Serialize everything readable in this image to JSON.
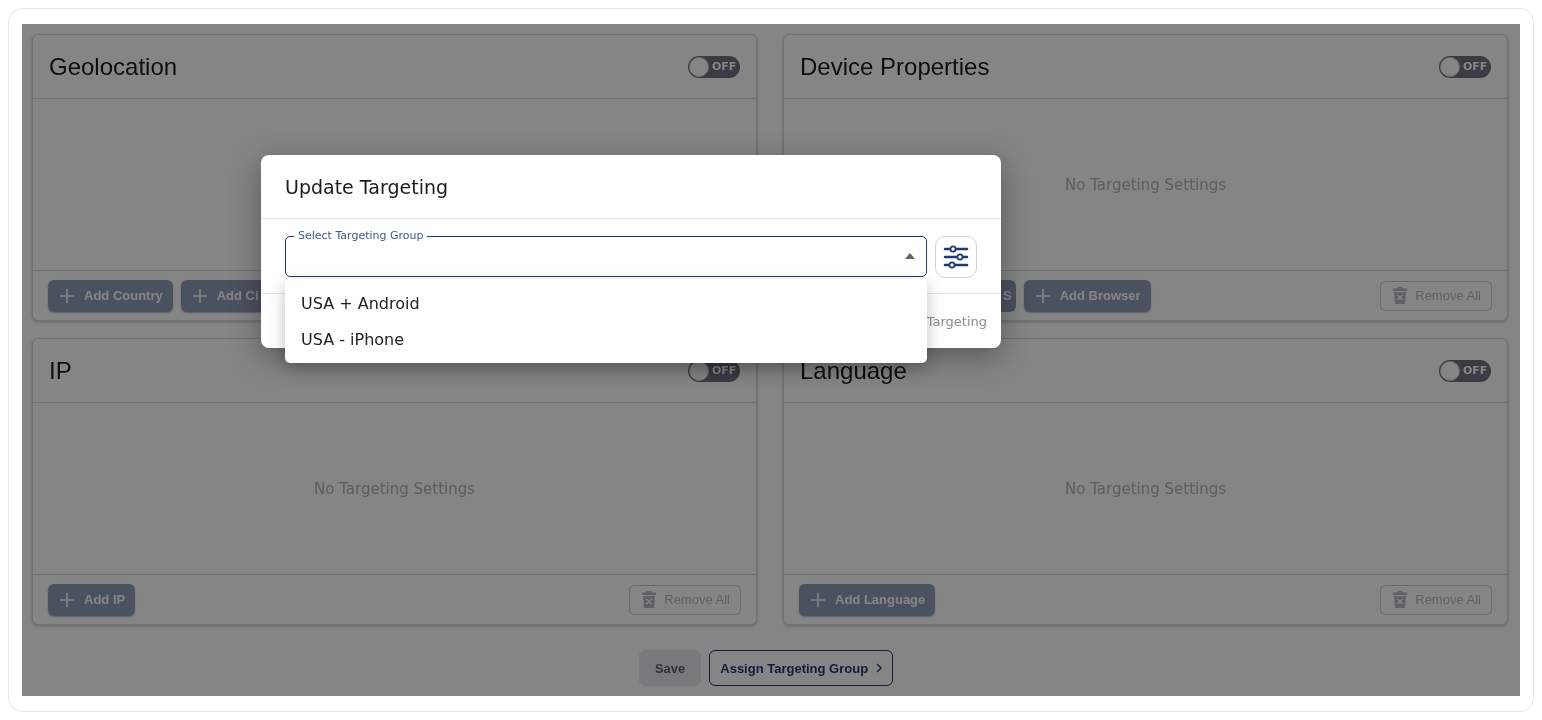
{
  "panels": [
    {
      "title": "Geolocation",
      "toggle": {
        "label": "OFF",
        "on": false
      },
      "buttons": [
        {
          "kind": "add",
          "label": "Add Country"
        },
        {
          "kind": "add",
          "label": "Add Ci"
        }
      ]
    },
    {
      "title": "Device Properties",
      "toggle": {
        "label": "OFF",
        "on": false
      },
      "empty_text": "No Targeting Settings",
      "buttons": [
        {
          "kind": "partial",
          "label": "S"
        },
        {
          "kind": "add",
          "label": "Add Browser"
        }
      ],
      "remove_label": "Remove All"
    },
    {
      "title": "IP",
      "toggle": {
        "label": "OFF",
        "on": false
      },
      "empty_text": "No Targeting Settings",
      "buttons": [
        {
          "kind": "add",
          "label": "Add IP"
        }
      ],
      "remove_label": "Remove All"
    },
    {
      "title": "Language",
      "toggle": {
        "label": "OFF",
        "on": false
      },
      "empty_text": "No Targeting Settings",
      "buttons": [
        {
          "kind": "add",
          "label": "Add Language"
        }
      ],
      "remove_label": "Remove All"
    }
  ],
  "actions": [
    {
      "kind": "plain",
      "label": "Save",
      "disabled": true
    },
    {
      "kind": "next",
      "label": "Assign Targeting Group",
      "disabled": false
    }
  ],
  "modal": {
    "title": "Update Targeting",
    "select": {
      "label": "Select Targeting Group",
      "expanded": true
    },
    "options": [
      {
        "label": "USA + Android",
        "selected": false
      },
      {
        "label": "USA - iPhone",
        "selected": false
      }
    ],
    "footer_button": "Targeting"
  }
}
